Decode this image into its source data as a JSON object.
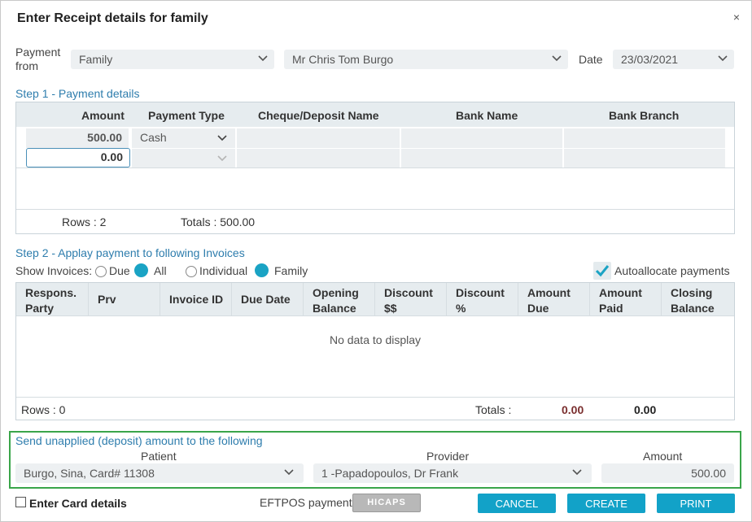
{
  "dialog": {
    "title": "Enter Receipt details for family",
    "close": "×"
  },
  "header": {
    "payment_from_label": "Payment from",
    "payment_from_type": "Family",
    "payer_name": "Mr Chris Tom Burgo",
    "date_label": "Date",
    "date_value": "23/03/2021"
  },
  "step1": {
    "title": "Step 1 - Payment details",
    "columns": [
      "Amount",
      "Payment Type",
      "Cheque/Deposit Name",
      "Bank Name",
      "Bank Branch"
    ],
    "rows": [
      {
        "amount": "500.00",
        "payment_type": "Cash"
      },
      {
        "amount": "0.00",
        "payment_type": ""
      }
    ],
    "footer_rows": "Rows : 2",
    "footer_totals": "Totals : 500.00"
  },
  "step2": {
    "title": "Step 2 - Applay payment to following Invoices",
    "show_invoices_label": "Show Invoices:",
    "options": {
      "due": "Due",
      "all": "All",
      "individual": "Individual",
      "family": "Family"
    },
    "autoallocate_label": "Autoallocate payments",
    "columns": [
      [
        "Respons.",
        "Party"
      ],
      [
        "Prv",
        ""
      ],
      [
        "Invoice ID",
        ""
      ],
      [
        "Due Date",
        ""
      ],
      [
        "Opening",
        "Balance"
      ],
      [
        "Discount",
        "$$"
      ],
      [
        "Discount",
        "%"
      ],
      [
        "Amount",
        "Due"
      ],
      [
        "Amount",
        "Paid"
      ],
      [
        "Closing",
        "Balance"
      ]
    ],
    "empty_text": "No data to display",
    "footer_rows": "Rows : 0",
    "totals_label": "Totals :",
    "total_due": "0.00",
    "total_paid": "0.00",
    "colors": {
      "total_due": "#7a2e2e",
      "accent": "#12a2c8",
      "step_title": "#2e7dad",
      "highlight_border": "#3aa54a"
    }
  },
  "deposit": {
    "title": "Send unapplied (deposit) amount to the following",
    "patient_label": "Patient",
    "patient_value": "Burgo, Sina, Card# 11308",
    "provider_label": "Provider",
    "provider_value": "1 -Papadopoulos, Dr Frank",
    "amount_label": "Amount",
    "amount_value": "500.00"
  },
  "footer": {
    "card_details_label": "Enter Card details",
    "eftpos_label": "EFTPOS payment",
    "eftpos_logo_text": "HICAPS",
    "cancel": "CANCEL",
    "create": "CREATE",
    "print": "PRINT"
  }
}
